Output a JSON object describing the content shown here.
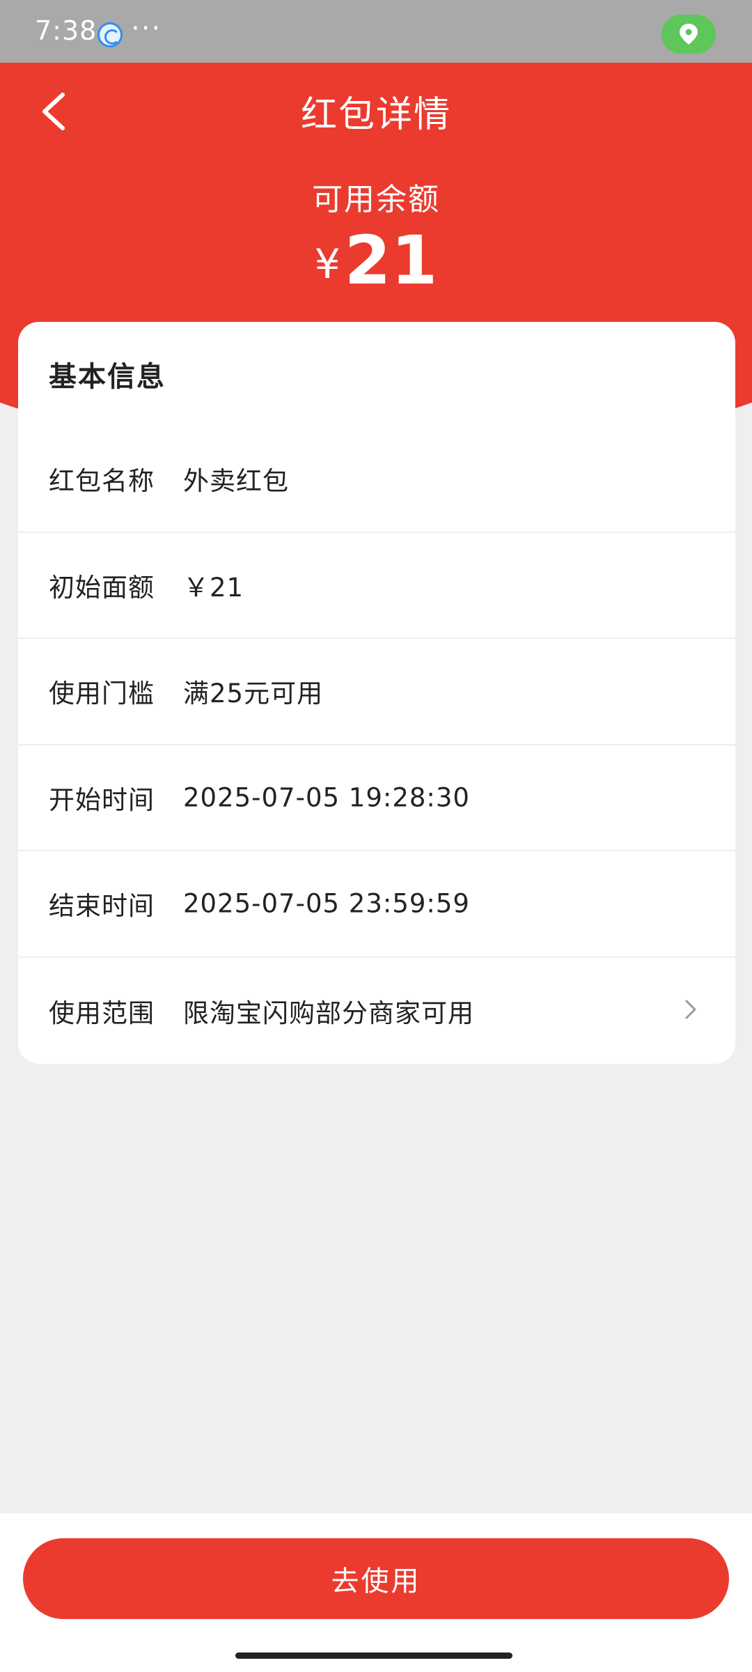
{
  "status_bar": {
    "time": "7:38",
    "more": "···",
    "app_icon": "browser-icon",
    "location_icon": "location-pin-icon"
  },
  "header": {
    "title": "红包详情",
    "back_icon": "chevron-left-icon",
    "balance_label": "可用余额",
    "currency": "¥",
    "balance": "21"
  },
  "card": {
    "title": "基本信息",
    "rows": [
      {
        "label": "红包名称",
        "value": "外卖红包"
      },
      {
        "label": "初始面额",
        "value": "￥21"
      },
      {
        "label": "使用门槛",
        "value": "满25元可用"
      },
      {
        "label": "开始时间",
        "value": "2025-07-05 19:28:30"
      },
      {
        "label": "结束时间",
        "value": "2025-07-05 23:59:59"
      },
      {
        "label": "使用范围",
        "value": "限淘宝闪购部分商家可用",
        "chevron_icon": "chevron-right-icon"
      }
    ]
  },
  "footer": {
    "button_label": "去使用"
  },
  "colors": {
    "brand_red": "#eb3b2f",
    "status_bar": "#a9a9a9",
    "location_green": "#5ec65a",
    "background": "#efefef"
  }
}
